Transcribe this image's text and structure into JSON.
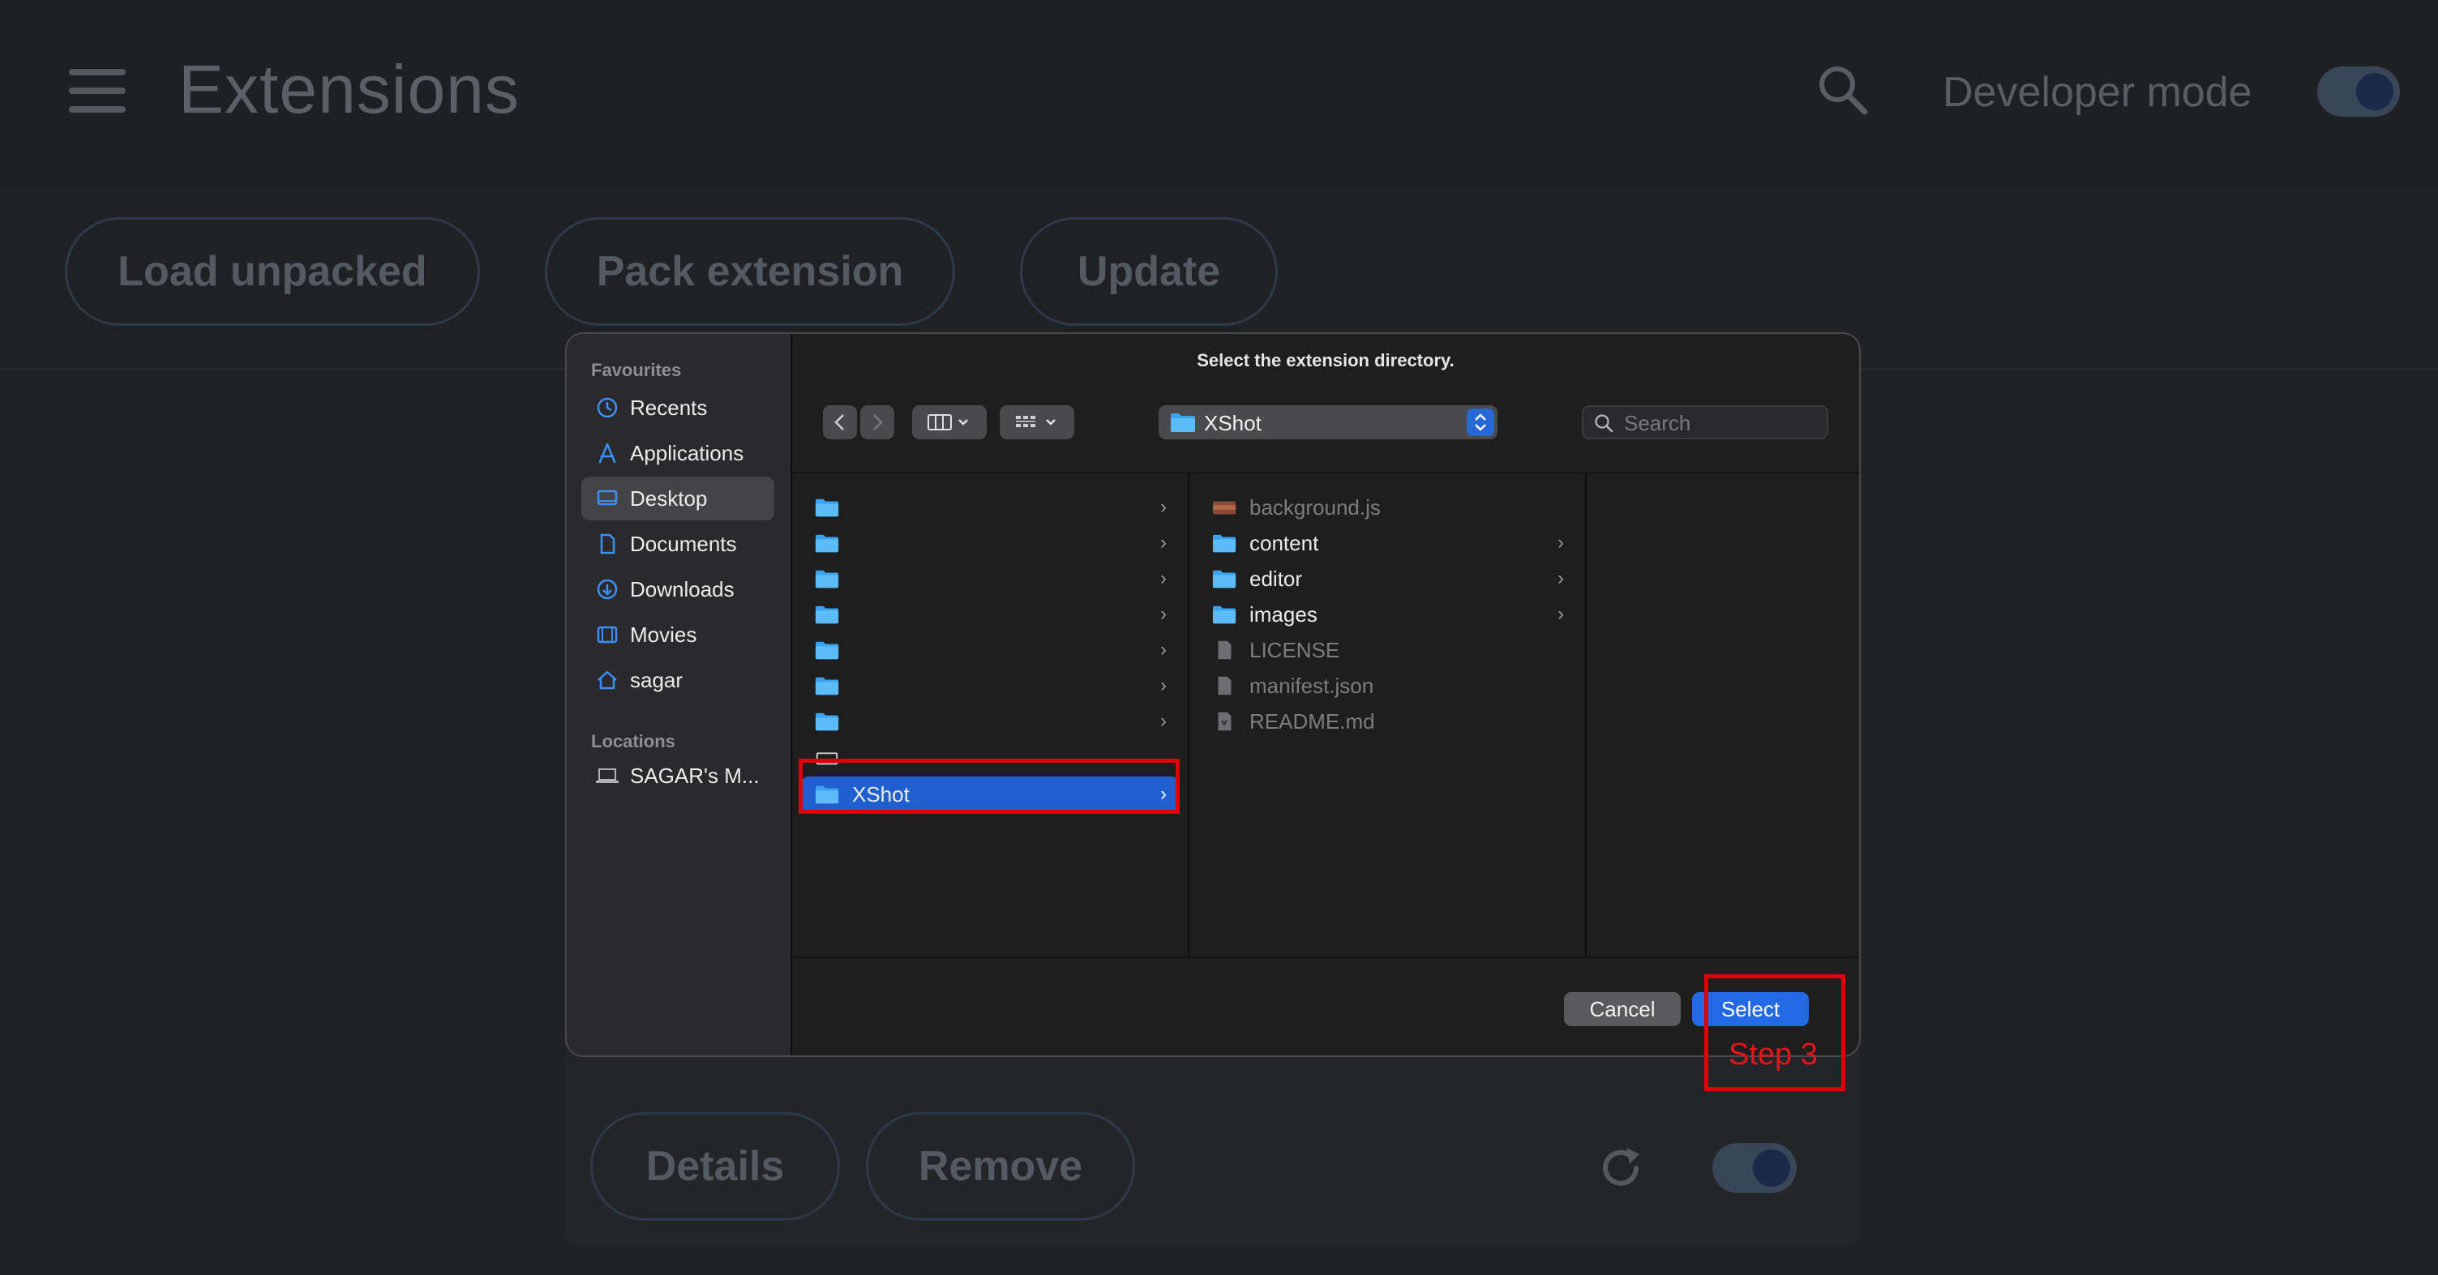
{
  "extensions_page": {
    "title": "Extensions",
    "developer_mode_label": "Developer mode",
    "developer_mode_on": true,
    "toolbar_buttons": [
      "Load unpacked",
      "Pack extension",
      "Update"
    ],
    "card_buttons": [
      "Details",
      "Remove"
    ],
    "card_toggle_on": true
  },
  "dialog": {
    "title": "Select the extension directory.",
    "sidebar": {
      "favourites_heading": "Favourites",
      "favourites": [
        {
          "label": "Recents",
          "icon": "clock-icon"
        },
        {
          "label": "Applications",
          "icon": "applications-icon"
        },
        {
          "label": "Desktop",
          "icon": "desktop-icon",
          "active": true
        },
        {
          "label": "Documents",
          "icon": "document-icon"
        },
        {
          "label": "Downloads",
          "icon": "download-icon"
        },
        {
          "label": "Movies",
          "icon": "film-icon"
        },
        {
          "label": "sagar",
          "icon": "home-icon"
        }
      ],
      "locations_heading": "Locations",
      "locations": [
        {
          "label": "SAGAR's M...",
          "icon": "laptop-icon"
        }
      ]
    },
    "location": "XShot",
    "search_placeholder": "Search",
    "column1": {
      "selected": "XShot",
      "rows": [
        {
          "name": "",
          "type": "folder"
        },
        {
          "name": "",
          "type": "folder"
        },
        {
          "name": "",
          "type": "folder"
        },
        {
          "name": "",
          "type": "folder"
        },
        {
          "name": "",
          "type": "folder"
        },
        {
          "name": "",
          "type": "folder"
        },
        {
          "name": "",
          "type": "folder"
        },
        {
          "name": "",
          "type": "drive"
        },
        {
          "name": "XShot",
          "type": "folder",
          "selected": true
        }
      ]
    },
    "column2": {
      "rows": [
        {
          "name": "background.js",
          "type": "file-image",
          "dim": true
        },
        {
          "name": "content",
          "type": "folder"
        },
        {
          "name": "editor",
          "type": "folder"
        },
        {
          "name": "images",
          "type": "folder"
        },
        {
          "name": "LICENSE",
          "type": "file",
          "dim": true
        },
        {
          "name": "manifest.json",
          "type": "file",
          "dim": true
        },
        {
          "name": "README.md",
          "type": "file",
          "dim": true
        }
      ]
    },
    "buttons": {
      "cancel": "Cancel",
      "select": "Select"
    }
  },
  "annotations": {
    "step_label": "Step 3",
    "color": "#e0000a"
  }
}
